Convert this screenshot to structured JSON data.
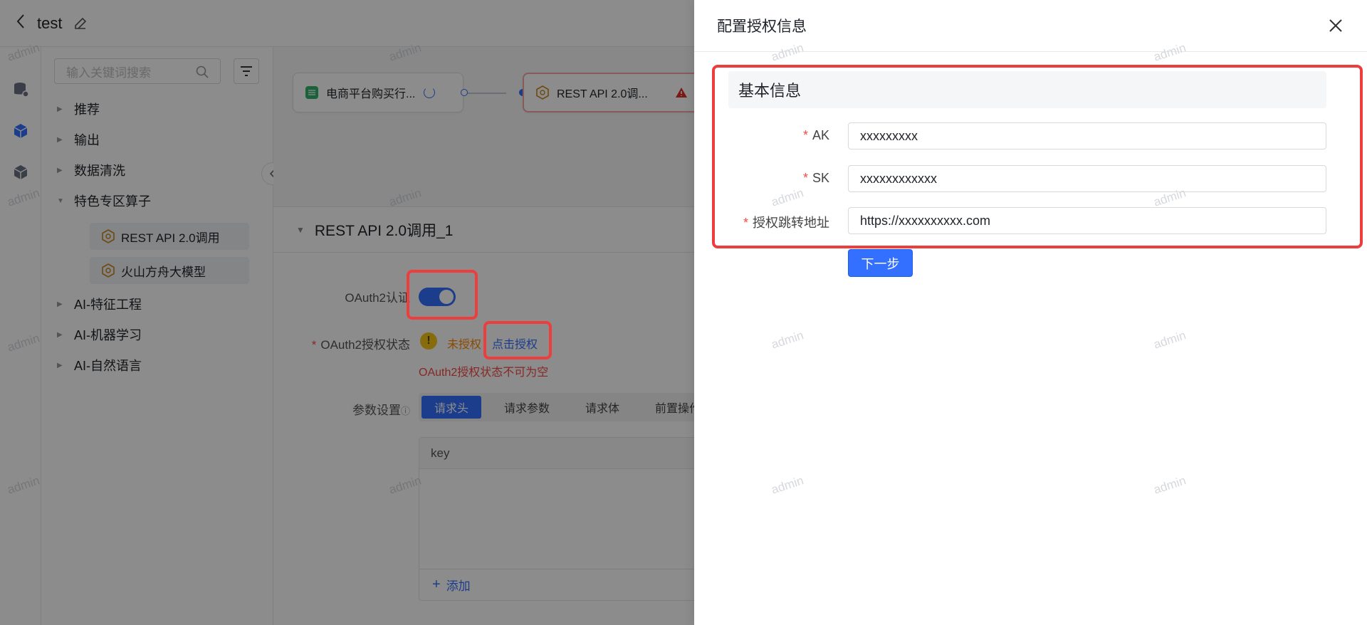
{
  "app": {
    "title": "test",
    "search": {
      "placeholder": "输入关键词搜索"
    },
    "tree": [
      {
        "label": "推荐"
      },
      {
        "label": "输出"
      },
      {
        "label": "数据清洗"
      },
      {
        "label": "特色专区算子"
      },
      {
        "label": "AI-特征工程"
      },
      {
        "label": "AI-机器学习"
      },
      {
        "label": "AI-自然语言"
      }
    ],
    "tree_children": [
      {
        "label": "REST API 2.0调用"
      },
      {
        "label": "火山方舟大模型"
      }
    ],
    "canvas": {
      "nodes": [
        {
          "label": "电商平台购买行..."
        },
        {
          "label": "REST API 2.0调..."
        }
      ]
    },
    "detail": {
      "title": "REST API 2.0调用_1",
      "oauth_label": "OAuth2认证",
      "oauth_enabled": true,
      "auth_status_label": "OAuth2授权状态",
      "auth_status": "未授权",
      "auth_link": "点击授权",
      "auth_error": "OAuth2授权状态不可为空",
      "params_label": "参数设置",
      "tabs": [
        {
          "label": "请求头"
        },
        {
          "label": "请求参数"
        },
        {
          "label": "请求体"
        },
        {
          "label": "前置操作"
        }
      ],
      "table_header": "key",
      "add_label": "添加"
    }
  },
  "drawer": {
    "title": "配置授权信息",
    "section_title": "基本信息",
    "fields": [
      {
        "label": "AK",
        "value": "xxxxxxxxx"
      },
      {
        "label": "SK",
        "value": "xxxxxxxxxxxx"
      },
      {
        "label": "授权跳转地址",
        "value": "https://xxxxxxxxxx.com"
      }
    ],
    "next_label": "下一步"
  },
  "watermark": "admin",
  "colors": {
    "primary": "#3370ff",
    "danger": "#f54a45",
    "warning": "#ff8800",
    "highlight": "#ee3d3d"
  }
}
